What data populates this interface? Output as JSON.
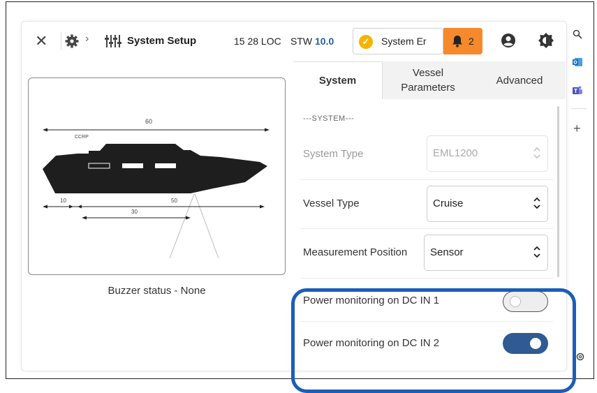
{
  "header": {
    "close_glyph": "✕",
    "breadcrumb_chevron": "›",
    "title": "System Setup",
    "time": "15 28 LOC",
    "stw_label": "STW",
    "stw_value": "10.0",
    "system_status": "System Er",
    "alarm_count": "2"
  },
  "diagram": {
    "overall_length": "60",
    "ccrp_label": "CCRP",
    "dim_10": "10",
    "dim_50": "50",
    "dim_30": "30"
  },
  "buzzer_status": "Buzzer status - None",
  "tabs": [
    {
      "label": "System",
      "active": true
    },
    {
      "label_line1": "Vessel",
      "label_line2": "Parameters",
      "active": false
    },
    {
      "label": "Advanced",
      "active": false
    }
  ],
  "system": {
    "section_header": "---SYSTEM---",
    "system_type_label": "System Type",
    "system_type_value": "EML1200",
    "vessel_type_label": "Vessel Type",
    "vessel_type_value": "Cruise",
    "measurement_position_label": "Measurement Position",
    "measurement_position_value": "Sensor",
    "power_dc1_label": "Power monitoring on DC IN 1",
    "power_dc1_on": false,
    "power_dc2_label": "Power monitoring on DC IN 2",
    "power_dc2_on": true
  },
  "side_strip": {
    "add_glyph": "+"
  },
  "colors": {
    "accent_blue": "#2f5a93",
    "stw_blue": "#1f5fa8",
    "alarm_orange": "#f5892b",
    "status_yellow": "#f5b400",
    "highlight_blue": "#1c5db8"
  }
}
